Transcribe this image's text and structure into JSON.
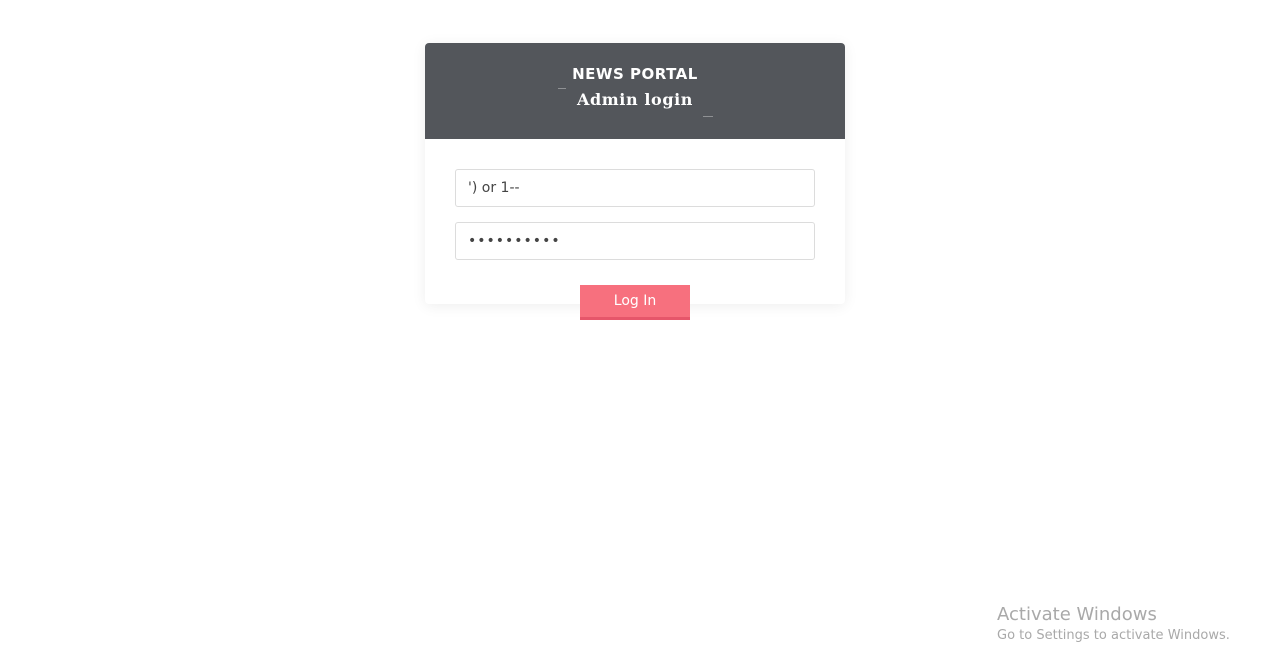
{
  "header": {
    "brand_title": "NEWS PORTAL",
    "subtitle": "Admin login"
  },
  "form": {
    "username_value": "') or 1--",
    "password_value": "••••••••••",
    "login_label": "Log In"
  },
  "colors": {
    "header_bg": "#53565b",
    "button_bg": "#f7707e",
    "button_border": "#e6566a"
  },
  "watermark": {
    "title": "Activate Windows",
    "subtitle": "Go to Settings to activate Windows."
  }
}
